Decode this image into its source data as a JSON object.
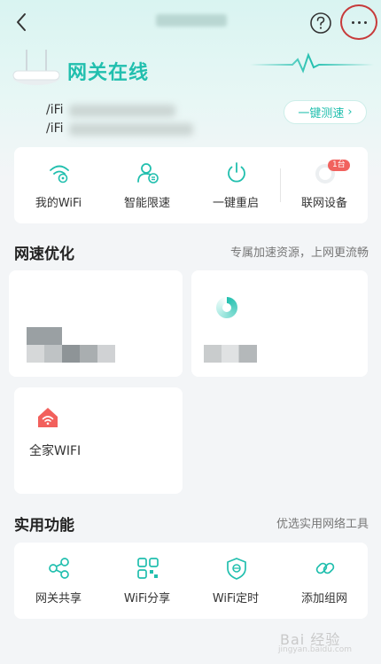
{
  "header": {
    "status": "网关在线",
    "wifi_line_1": "/iFi",
    "wifi_line_2": "/iFi",
    "speedtest_label": "一键测速",
    "speedtest_chevron": "›"
  },
  "quick_actions": [
    {
      "label": "我的WiFi",
      "icon": "wifi-settings-icon"
    },
    {
      "label": "智能限速",
      "icon": "user-speed-icon"
    },
    {
      "label": "一键重启",
      "icon": "power-icon"
    },
    {
      "label": "联网设备",
      "icon": "device-icon",
      "badge": "1台"
    }
  ],
  "optimization": {
    "title": "网速优化",
    "subtitle": "专属加速资源，上网更流畅"
  },
  "family_wifi": {
    "label": "全家WIFI",
    "icon": "home-wifi-icon"
  },
  "tools": {
    "title": "实用功能",
    "subtitle": "优选实用网络工具",
    "items": [
      {
        "label": "网关共享",
        "icon": "share-icon"
      },
      {
        "label": "WiFi分享",
        "icon": "qr-code-icon"
      },
      {
        "label": "WiFi定时",
        "icon": "shield-timer-icon"
      },
      {
        "label": "添加组网",
        "icon": "link-icon"
      }
    ]
  },
  "watermark": {
    "text": "Bai 经验",
    "sub": "jingyan.baidu.com"
  },
  "colors": {
    "accent": "#21bfae",
    "highlight": "#c73a3a",
    "badge": "#f1625e"
  }
}
